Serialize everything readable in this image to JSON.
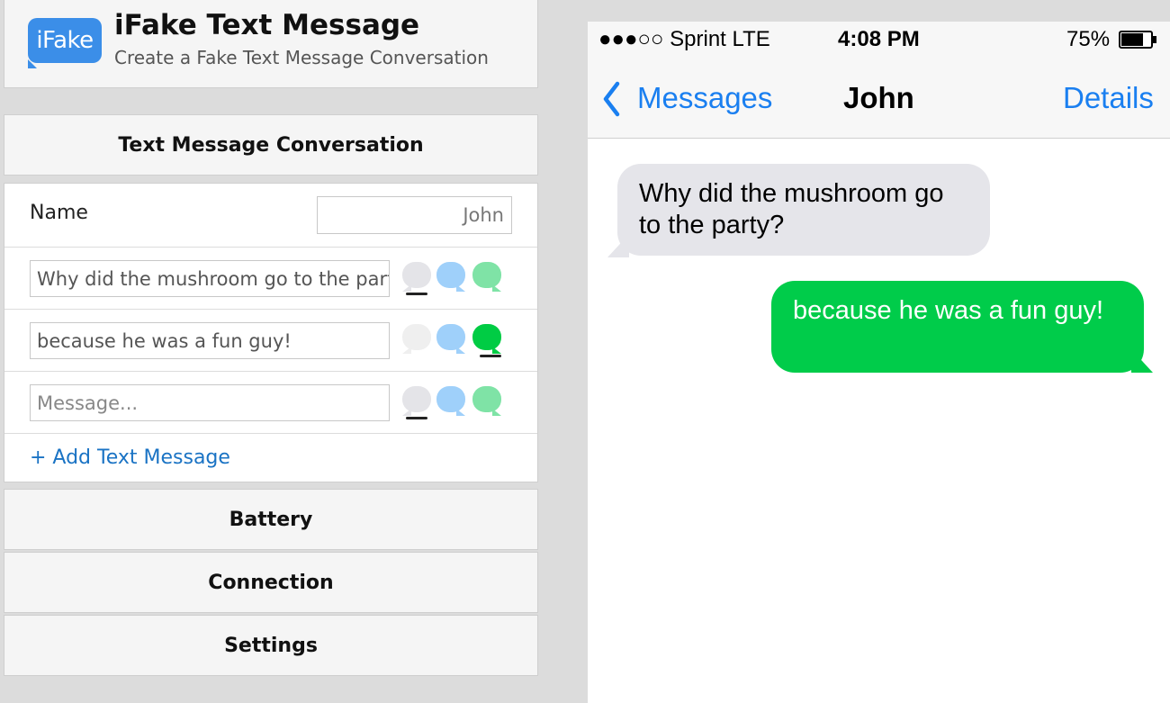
{
  "app": {
    "title": "iFake Text Message",
    "subtitle": "Create a Fake Text Message Conversation",
    "logo_text": "iFake",
    "logo_color": "#3b8ee8"
  },
  "conversation_panel": {
    "heading": "Text Message Conversation",
    "name_label": "Name",
    "name_value": "John",
    "messages": [
      {
        "value": "Why did the mushroom go to the party?",
        "selected_style": "grey"
      },
      {
        "value": "because he was a fun guy!",
        "selected_style": "green"
      },
      {
        "value": "",
        "placeholder": "Message...",
        "selected_style": "grey"
      }
    ],
    "add_message_label": "+ Add Text Message"
  },
  "sections": {
    "battery": "Battery",
    "connection": "Connection",
    "settings": "Settings"
  },
  "phone": {
    "status": {
      "carrier": "●●●○○ Sprint  LTE",
      "time": "4:08 PM",
      "battery_percent": "75%",
      "battery_level": 0.75
    },
    "nav": {
      "back_label": "Messages",
      "title": "John",
      "details_label": "Details"
    },
    "bubbles": [
      {
        "side": "incoming",
        "text": "Why did the mushroom go to the party?"
      },
      {
        "side": "outgoing",
        "text": "because he was a fun guy!"
      }
    ]
  },
  "colors": {
    "ios_blue": "#1a7ff0",
    "incoming_bubble": "#e5e5ea",
    "outgoing_bubble": "#00cc4a",
    "link_blue": "#1a73c4"
  },
  "icons": [
    "chevron-left-icon",
    "battery-icon",
    "grey-bubble-icon",
    "blue-bubble-icon",
    "green-bubble-icon"
  ]
}
